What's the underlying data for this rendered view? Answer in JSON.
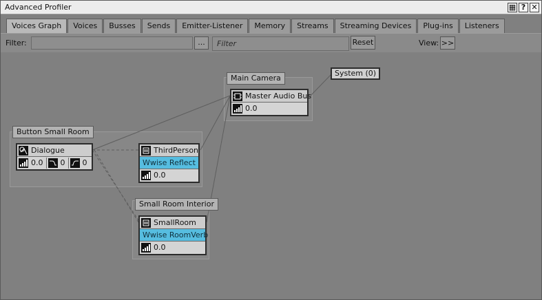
{
  "window": {
    "title": "Advanced Profiler"
  },
  "titlebar_buttons": [
    {
      "name": "layout",
      "glyph": "▦"
    },
    {
      "name": "help",
      "glyph": "?"
    },
    {
      "name": "close",
      "glyph": "✕"
    }
  ],
  "tabs": [
    "Voices Graph",
    "Voices",
    "Busses",
    "Sends",
    "Emitter-Listener",
    "Memory",
    "Streams",
    "Streaming Devices",
    "Plug-ins",
    "Listeners"
  ],
  "active_tab": "Voices Graph",
  "filter": {
    "label": "Filter:",
    "value": "",
    "browse_label": "...",
    "search_placeholder": "Filter",
    "reset_label": "Reset",
    "view_label": "View:",
    "view_button": ">>"
  },
  "graph": {
    "groups": {
      "button_small_room": "Button Small Room",
      "main_camera": "Main Camera",
      "small_room_interior": "Small Room Interior"
    },
    "system": "System (0)",
    "nodes": {
      "dialogue": {
        "name": "Dialogue",
        "volume": "0.0",
        "lpf": "0",
        "hpf": "0"
      },
      "third_person": {
        "name": "ThirdPerson",
        "effect": "Wwise Reflect",
        "volume": "0.0"
      },
      "master_bus": {
        "name": "Master Audio Bus",
        "volume": "0.0"
      },
      "small_room": {
        "name": "SmallRoom",
        "effect": "Wwise RoomVerb",
        "volume": "0.0"
      }
    }
  },
  "colors": {
    "effect_row": "#56bde0",
    "canvas": "#808080",
    "node_border": "#2c2c2c"
  }
}
